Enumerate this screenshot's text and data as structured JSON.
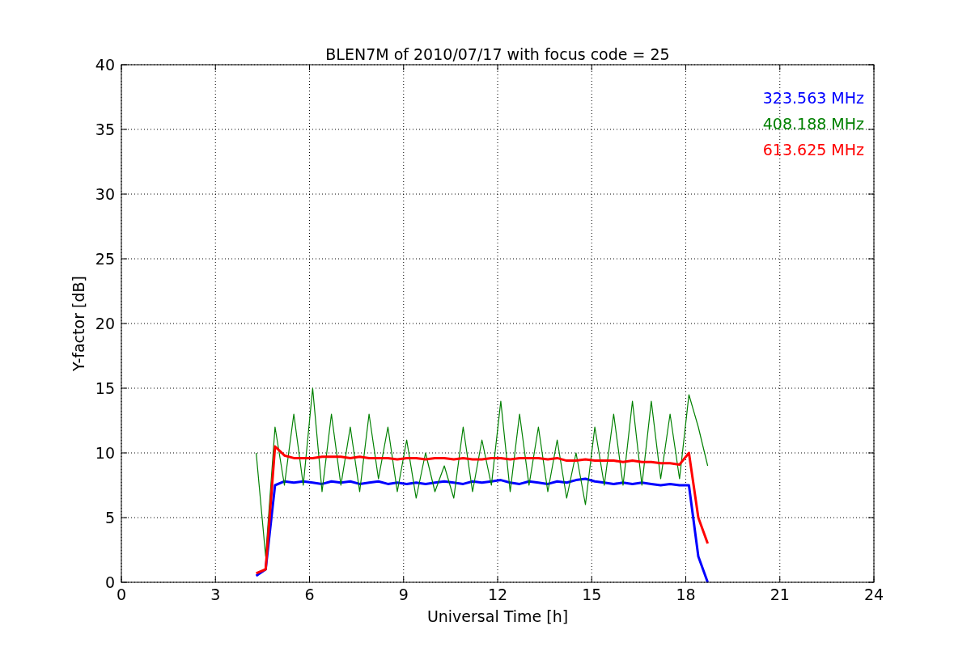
{
  "chart_data": {
    "type": "line",
    "title": "BLEN7M of 2010/07/17 with focus code = 25",
    "xlabel": "Universal Time [h]",
    "ylabel": "Y-factor [dB]",
    "xlim": [
      0,
      24
    ],
    "ylim": [
      0,
      40
    ],
    "xticks": [
      0,
      3,
      6,
      9,
      12,
      15,
      18,
      21,
      24
    ],
    "yticks": [
      0,
      5,
      10,
      15,
      20,
      25,
      30,
      35,
      40
    ],
    "grid": true,
    "x": [
      4.3,
      4.6,
      4.9,
      5.2,
      5.5,
      5.8,
      6.1,
      6.4,
      6.7,
      7.0,
      7.3,
      7.6,
      7.9,
      8.2,
      8.5,
      8.8,
      9.1,
      9.4,
      9.7,
      10.0,
      10.3,
      10.6,
      10.9,
      11.2,
      11.5,
      11.8,
      12.1,
      12.4,
      12.7,
      13.0,
      13.3,
      13.6,
      13.9,
      14.2,
      14.5,
      14.8,
      15.1,
      15.4,
      15.7,
      16.0,
      16.3,
      16.6,
      16.9,
      17.2,
      17.5,
      17.8,
      18.1,
      18.4,
      18.7
    ],
    "series": [
      {
        "name": "323.563 MHz",
        "color": "#0000ff",
        "values": [
          0.5,
          1,
          7.5,
          7.8,
          7.7,
          7.8,
          7.7,
          7.6,
          7.8,
          7.7,
          7.8,
          7.6,
          7.7,
          7.8,
          7.6,
          7.7,
          7.6,
          7.7,
          7.6,
          7.7,
          7.8,
          7.7,
          7.6,
          7.8,
          7.7,
          7.8,
          7.9,
          7.7,
          7.6,
          7.8,
          7.7,
          7.6,
          7.8,
          7.7,
          7.9,
          8,
          7.8,
          7.7,
          7.6,
          7.7,
          7.6,
          7.7,
          7.6,
          7.5,
          7.6,
          7.5,
          7.5,
          2,
          0
        ]
      },
      {
        "name": "408.188 MHz",
        "color": "#008000",
        "values": [
          10,
          2,
          12,
          7.5,
          13,
          7.5,
          15,
          7,
          13,
          7.5,
          12,
          7,
          13,
          8,
          12,
          7,
          11,
          6.5,
          10,
          7,
          9,
          6.5,
          12,
          7,
          11,
          7.5,
          14,
          7,
          13,
          7.5,
          12,
          7,
          11,
          6.5,
          10,
          6,
          12,
          7.5,
          13,
          7.5,
          14,
          7.5,
          14,
          8,
          13,
          8,
          14.5,
          12,
          9
        ]
      },
      {
        "name": "613.625 MHz",
        "color": "#ff0000",
        "values": [
          0.7,
          1,
          10.5,
          9.8,
          9.6,
          9.6,
          9.6,
          9.7,
          9.7,
          9.7,
          9.6,
          9.7,
          9.6,
          9.6,
          9.6,
          9.5,
          9.6,
          9.6,
          9.5,
          9.6,
          9.6,
          9.5,
          9.6,
          9.5,
          9.5,
          9.6,
          9.6,
          9.5,
          9.6,
          9.6,
          9.6,
          9.5,
          9.6,
          9.4,
          9.4,
          9.5,
          9.4,
          9.4,
          9.4,
          9.3,
          9.4,
          9.3,
          9.3,
          9.2,
          9.2,
          9.1,
          10,
          5,
          3
        ]
      }
    ]
  }
}
